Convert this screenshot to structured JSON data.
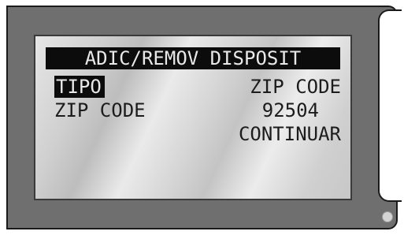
{
  "screen": {
    "title": "ADIC/REMOV DISPOSIT",
    "rows": [
      {
        "left": "TIPO",
        "right": "ZIP CODE"
      },
      {
        "left": "ZIP CODE",
        "right": "92504"
      },
      {
        "left": "",
        "right": "CONTINUAR"
      }
    ]
  }
}
